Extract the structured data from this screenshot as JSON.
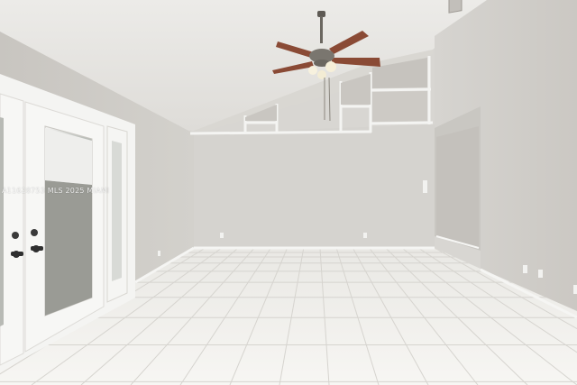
{
  "photo": {
    "watermark_text": "A11628753 MLS 2025 MIAMI",
    "colors": {
      "ceiling": "#e8e7e4",
      "wall_back": "#d6d4d0",
      "wall_left": "#cfccc7",
      "wall_right": "#d2d0cc",
      "floor_tile": "#f2f1ee",
      "grout": "#d9d7d2",
      "trim": "#f6f6f4",
      "fan_body": "#6b6760",
      "fan_blade": "#8a4a35"
    },
    "icons": [
      "ceiling-fan-icon",
      "door-handle-icon"
    ]
  }
}
